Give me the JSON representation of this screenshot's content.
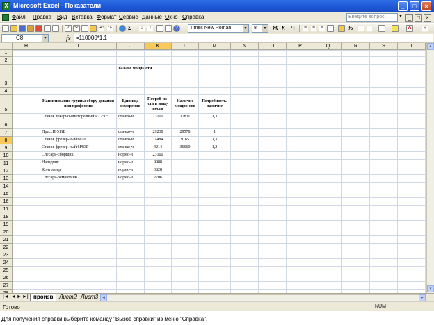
{
  "window": {
    "title": "Microsoft Excel - Показатели",
    "app_icon": "excel-icon"
  },
  "menubar": {
    "items": [
      "Файл",
      "Правка",
      "Вид",
      "Вставка",
      "Формат",
      "Сервис",
      "Данные",
      "Окно",
      "Справка"
    ],
    "question_placeholder": "Введите вопрос"
  },
  "toolbar": {
    "font": "Times New Roman",
    "size": "8",
    "bold": "Ж",
    "italic": "К",
    "underline": "Ч",
    "percent": "%",
    "sigma": "Σ"
  },
  "formulabar": {
    "cell_ref": "C8",
    "fx": "fx",
    "formula": "=110000*1,1"
  },
  "columns": [
    "H",
    "I",
    "J",
    "K",
    "L",
    "M",
    "N",
    "O",
    "P",
    "Q",
    "R",
    "S",
    "T"
  ],
  "active_column": "K",
  "rows": [
    "1",
    "2",
    "3",
    "4",
    "5",
    "6",
    "7",
    "8",
    "9",
    "10",
    "11",
    "12",
    "13",
    "14",
    "15",
    "16",
    "17",
    "18",
    "19",
    "20",
    "21",
    "22",
    "23",
    "24",
    "25",
    "26",
    "27",
    "28",
    "29"
  ],
  "active_row": "8",
  "table": {
    "title": "баланс мощности",
    "headers": [
      "Наименование группы обору-дования или профессии",
      "Единица измерения",
      "Потреб-но-сть в мощ-ности",
      "Наличие мощно-сти",
      "Потребность/ наличие"
    ],
    "rows": [
      [
        "Станок токарно-винторезный РТ2505",
        "станко-ч",
        "23100",
        "17811",
        "1,3"
      ],
      [
        "ПрессП-511Б",
        "станко-ч",
        "29238",
        "29578",
        "1"
      ],
      [
        "Станок фрезер-ный 6610",
        "станко-ч",
        "11484",
        "9165",
        "1,3"
      ],
      [
        "Станок фрезер-ный 6Р83Г",
        "станко-ч",
        "4214",
        "36660",
        "1,2"
      ],
      [
        "Слесарь-сборщик",
        "нормо-ч",
        "23100",
        "",
        ""
      ],
      [
        "Наладчик",
        "нормо-ч",
        "9988",
        "",
        ""
      ],
      [
        "Контролер",
        "нормо-ч",
        "3828",
        "",
        ""
      ],
      [
        "Слесарь-ремонтник",
        "нормо-ч",
        "2706",
        "",
        ""
      ]
    ]
  },
  "sheets": [
    "произв",
    "Лист2",
    "Лист3"
  ],
  "active_sheet": "произв",
  "status": {
    "ready": "Готово",
    "num": "NUM"
  },
  "hint": "Для получения справки выберите команду \"Вызов справки\" из меню \"Справка\"."
}
